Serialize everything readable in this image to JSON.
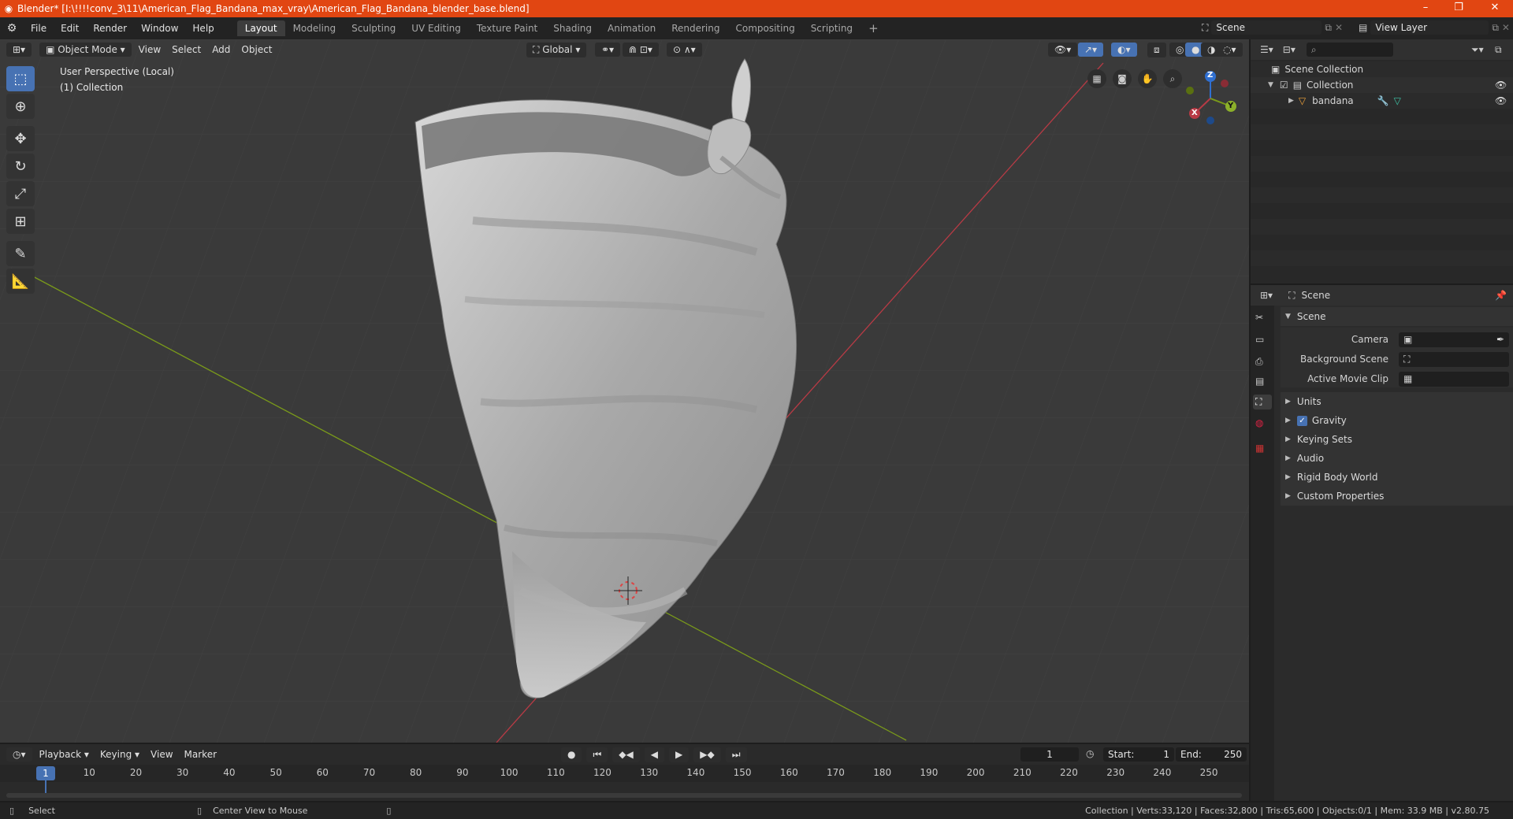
{
  "title_bar": {
    "title": "Blender* [I:\\!!!!conv_3\\11\\American_Flag_Bandana_max_vray\\American_Flag_Bandana_blender_base.blend]",
    "minimize": "–",
    "maximize": "❐",
    "close": "✕"
  },
  "menu": {
    "items": [
      "File",
      "Edit",
      "Render",
      "Window",
      "Help"
    ]
  },
  "workspaces": {
    "tabs": [
      "Layout",
      "Modeling",
      "Sculpting",
      "UV Editing",
      "Texture Paint",
      "Shading",
      "Animation",
      "Rendering",
      "Compositing",
      "Scripting"
    ],
    "add": "+"
  },
  "scene_selector": {
    "value": "Scene"
  },
  "view_layer_selector": {
    "value": "View Layer"
  },
  "viewport_header": {
    "mode": "Object Mode",
    "menus": [
      "View",
      "Select",
      "Add",
      "Object"
    ],
    "transform_orientation": "Global"
  },
  "viewport": {
    "perspective_label": "User Perspective (Local)",
    "collection_label": "(1) Collection",
    "gizmo": {
      "x": "X",
      "y": "Y",
      "z": "Z"
    },
    "colors": {
      "background": "#3a3a3a",
      "x_axis": "#b83a45",
      "y_axis": "#7a9a1a",
      "z_axis": "#2f6fd1",
      "accent": "#4772b3"
    }
  },
  "outliner": {
    "search_placeholder": "",
    "rows": [
      {
        "label": "Scene Collection"
      },
      {
        "label": "Collection"
      },
      {
        "label": "bandana"
      }
    ]
  },
  "properties": {
    "header_title": "Scene",
    "section_title": "Scene",
    "fields": [
      {
        "label": "Camera"
      },
      {
        "label": "Background Scene"
      },
      {
        "label": "Active Movie Clip"
      }
    ],
    "subpanels": [
      "Units",
      "Gravity",
      "Keying Sets",
      "Audio",
      "Rigid Body World",
      "Custom Properties"
    ],
    "gravity_checked": true
  },
  "timeline": {
    "menus": [
      "Playback",
      "Keying",
      "View",
      "Marker"
    ],
    "current_frame": "1",
    "start_label": "Start:",
    "start_value": "1",
    "end_label": "End:",
    "end_value": "250",
    "ruler_ticks": [
      "1",
      "10",
      "20",
      "30",
      "40",
      "50",
      "60",
      "70",
      "80",
      "90",
      "100",
      "110",
      "120",
      "130",
      "140",
      "150",
      "160",
      "170",
      "180",
      "190",
      "200",
      "210",
      "220",
      "230",
      "240",
      "250"
    ]
  },
  "status_bar": {
    "left_action": "Select",
    "middle_action": "Center View to Mouse",
    "stats": "Collection | Verts:33,120 | Faces:32,800 | Tris:65,600 | Objects:0/1 | Mem: 33.9 MB | v2.80.75"
  }
}
